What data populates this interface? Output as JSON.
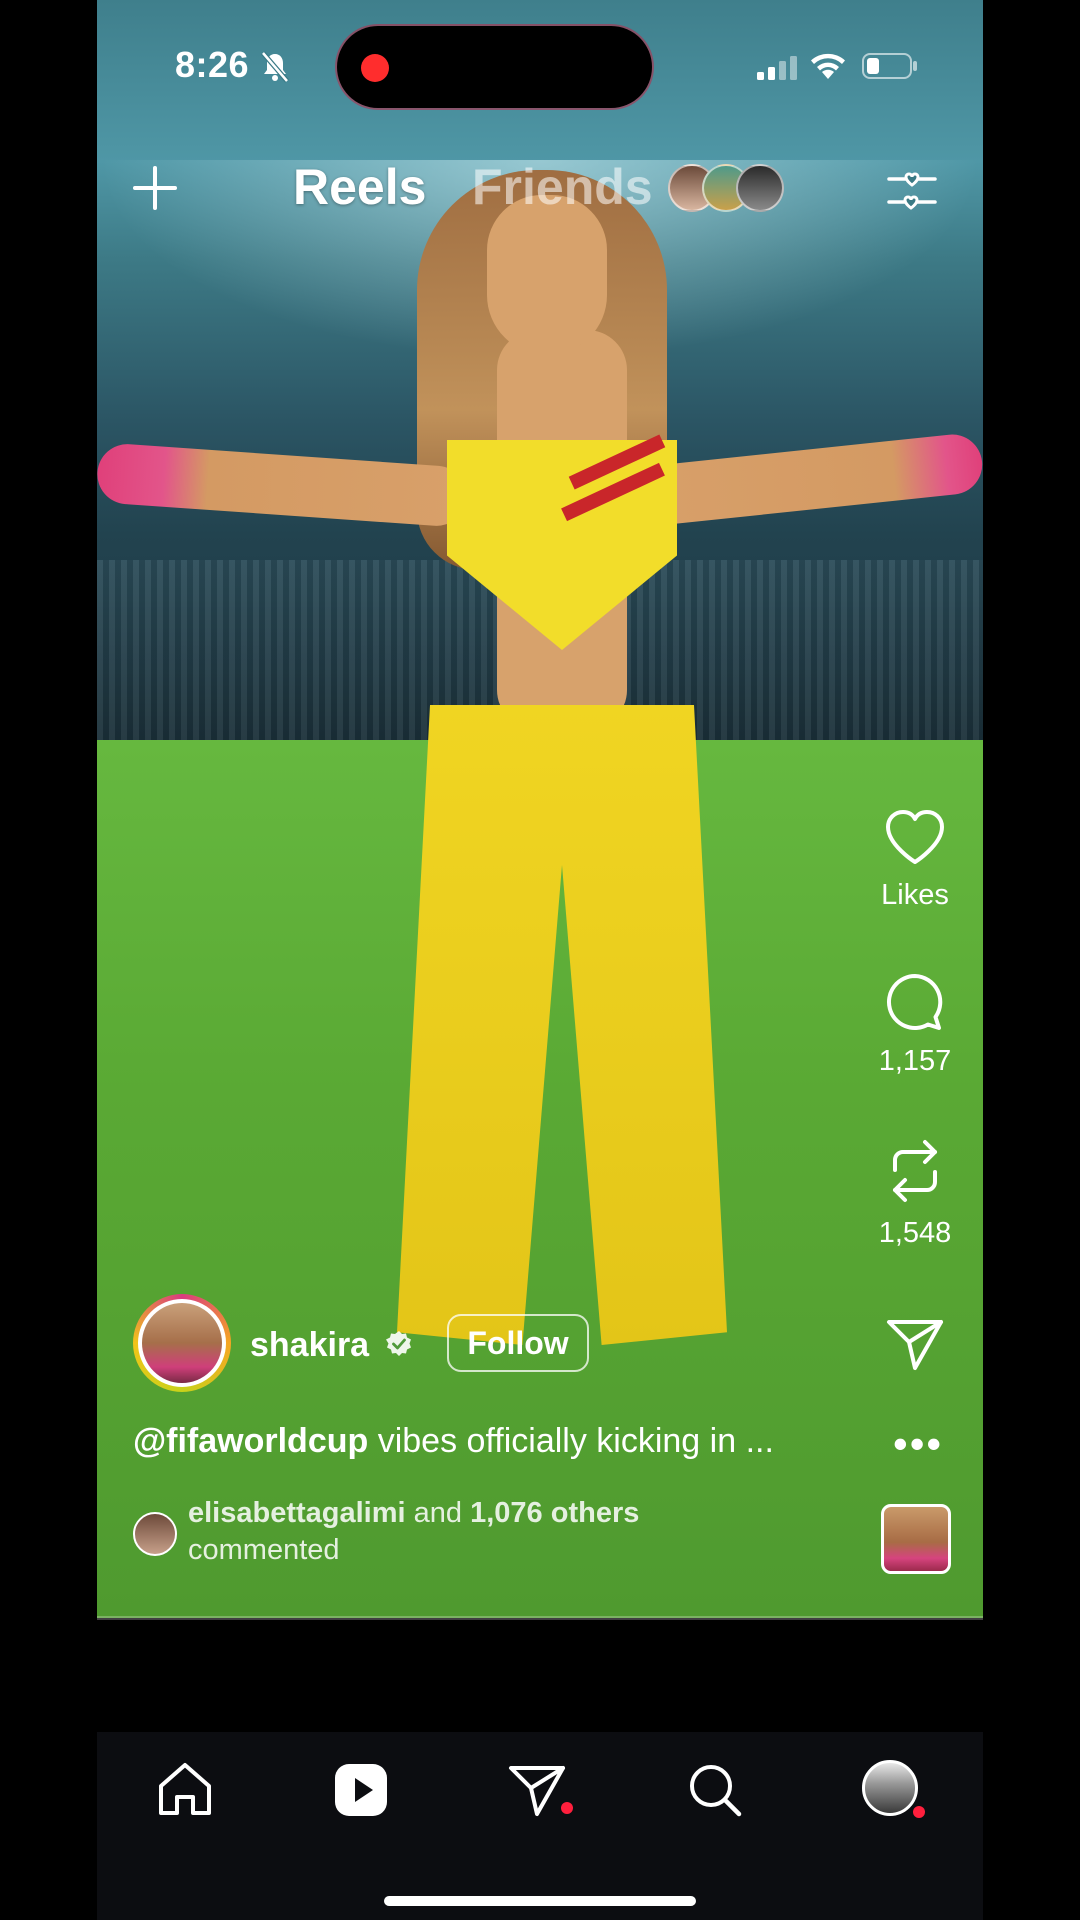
{
  "status_bar": {
    "time": "8:26"
  },
  "top_bar": {
    "tabs": [
      {
        "label": "Reels",
        "active": true
      },
      {
        "label": "Friends",
        "active": false
      }
    ]
  },
  "reel": {
    "author": {
      "username": "shakira",
      "verified": true,
      "follow_label": "Follow"
    },
    "caption": {
      "mention": "@fifaworldcup",
      "text": "vibes officially kicking in ..."
    },
    "comment_preview": {
      "user": "elisabettagalimi",
      "connector": "and",
      "others": "1,076 others",
      "suffix": "commented"
    },
    "actions": {
      "likes_label": "Likes",
      "comments_count": "1,157",
      "reposts_count": "1,548"
    },
    "progress": 0.0
  },
  "bottom_nav": {
    "items": [
      {
        "name": "home",
        "active": false
      },
      {
        "name": "reels",
        "active": true
      },
      {
        "name": "messages",
        "badge": true
      },
      {
        "name": "search",
        "active": false
      },
      {
        "name": "profile",
        "badge": true
      }
    ]
  },
  "colors": {
    "notification_dot": "#ff1f3d",
    "recording_dot": "#ff2d2d",
    "nav_background": "#0c0d11"
  }
}
